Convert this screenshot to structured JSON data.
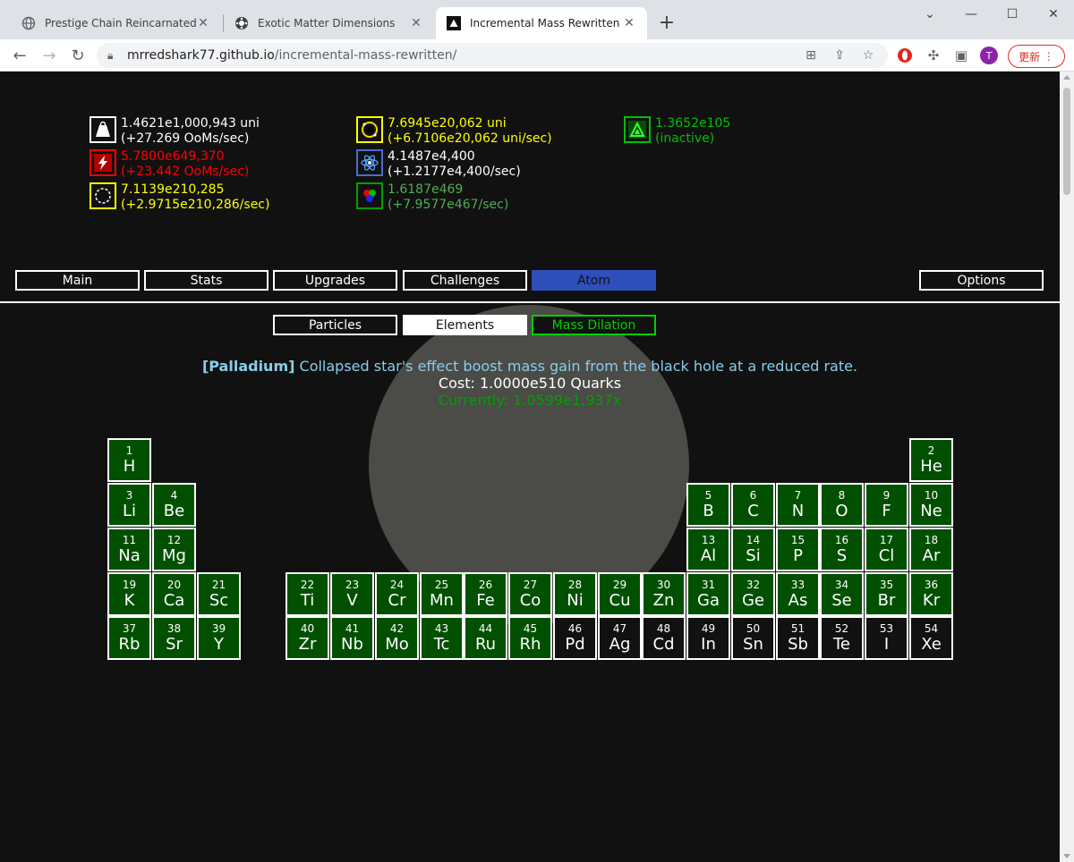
{
  "browser": {
    "tabs": [
      {
        "title": "Prestige Chain Reincarnated",
        "active": false
      },
      {
        "title": "Exotic Matter Dimensions",
        "active": false
      },
      {
        "title": "Incremental Mass Rewritten",
        "active": true
      }
    ],
    "url_host": "mrredshark77.github.io",
    "url_path": "/incremental-mass-rewritten/",
    "update_label": "更新",
    "avatar_letter": "T"
  },
  "resources": {
    "mass": {
      "value": "1.4621e1,000,943 uni",
      "rate": "(+27.269 OoMs/sec)",
      "color": "#ffffff"
    },
    "rage": {
      "value": "5.7800e649,370",
      "rate": "(+23.442 OoMs/sec)",
      "color": "#ff0000"
    },
    "dark": {
      "value": "7.1139e210,285",
      "rate": "(+2.9715e210,286/sec)",
      "color": "#ffff00"
    },
    "blackhole": {
      "value": "7.6945e20,062 uni",
      "rate": "(+6.7106e20,062 uni/sec)",
      "color": "#ffff00"
    },
    "atom": {
      "value": "4.1487e4,400",
      "rate": "(+1.2177e4,400/sec)",
      "color": "#ffffff"
    },
    "quark": {
      "value": "1.6187e469",
      "rate": "(+7.9577e467/sec)",
      "color": "#4caf50"
    },
    "dilation": {
      "value": "1.3652e105",
      "rate": "(inactive)",
      "color": "#00c000"
    }
  },
  "tabs": {
    "main": "Main",
    "stats": "Stats",
    "upgrades": "Upgrades",
    "challenges": "Challenges",
    "atom": "Atom",
    "options": "Options"
  },
  "subtabs": {
    "particles": "Particles",
    "elements": "Elements",
    "mass_dilation": "Mass Dilation"
  },
  "element_info": {
    "name": "[Palladium]",
    "desc": "Collapsed star's effect boost mass gain from the black hole at a reduced rate.",
    "cost": "Cost: 1.0000e510 Quarks",
    "current": "Currently: 1.0599e1,937x"
  },
  "colors": {
    "bought": "#005000",
    "unbought": "#111111",
    "active_tab": "#2f4fba",
    "info_blue": "#87ceeb",
    "info_green": "#00a000"
  },
  "elements": [
    {
      "n": "1",
      "s": "H",
      "bought": true
    },
    {
      "n": "2",
      "s": "He",
      "bought": true
    },
    {
      "n": "3",
      "s": "Li",
      "bought": true
    },
    {
      "n": "4",
      "s": "Be",
      "bought": true
    },
    {
      "n": "5",
      "s": "B",
      "bought": true
    },
    {
      "n": "6",
      "s": "C",
      "bought": true
    },
    {
      "n": "7",
      "s": "N",
      "bought": true
    },
    {
      "n": "8",
      "s": "O",
      "bought": true
    },
    {
      "n": "9",
      "s": "F",
      "bought": true
    },
    {
      "n": "10",
      "s": "Ne",
      "bought": true
    },
    {
      "n": "11",
      "s": "Na",
      "bought": true
    },
    {
      "n": "12",
      "s": "Mg",
      "bought": true
    },
    {
      "n": "13",
      "s": "Al",
      "bought": true
    },
    {
      "n": "14",
      "s": "Si",
      "bought": true
    },
    {
      "n": "15",
      "s": "P",
      "bought": true
    },
    {
      "n": "16",
      "s": "S",
      "bought": true
    },
    {
      "n": "17",
      "s": "Cl",
      "bought": true
    },
    {
      "n": "18",
      "s": "Ar",
      "bought": true
    },
    {
      "n": "19",
      "s": "K",
      "bought": true
    },
    {
      "n": "20",
      "s": "Ca",
      "bought": true
    },
    {
      "n": "21",
      "s": "Sc",
      "bought": true
    },
    {
      "n": "22",
      "s": "Ti",
      "bought": true
    },
    {
      "n": "23",
      "s": "V",
      "bought": true
    },
    {
      "n": "24",
      "s": "Cr",
      "bought": true
    },
    {
      "n": "25",
      "s": "Mn",
      "bought": true
    },
    {
      "n": "26",
      "s": "Fe",
      "bought": true
    },
    {
      "n": "27",
      "s": "Co",
      "bought": true
    },
    {
      "n": "28",
      "s": "Ni",
      "bought": true
    },
    {
      "n": "29",
      "s": "Cu",
      "bought": true
    },
    {
      "n": "30",
      "s": "Zn",
      "bought": true
    },
    {
      "n": "31",
      "s": "Ga",
      "bought": true
    },
    {
      "n": "32",
      "s": "Ge",
      "bought": true
    },
    {
      "n": "33",
      "s": "As",
      "bought": true
    },
    {
      "n": "34",
      "s": "Se",
      "bought": true
    },
    {
      "n": "35",
      "s": "Br",
      "bought": true
    },
    {
      "n": "36",
      "s": "Kr",
      "bought": true
    },
    {
      "n": "37",
      "s": "Rb",
      "bought": true
    },
    {
      "n": "38",
      "s": "Sr",
      "bought": true
    },
    {
      "n": "39",
      "s": "Y",
      "bought": true
    },
    {
      "n": "40",
      "s": "Zr",
      "bought": true
    },
    {
      "n": "41",
      "s": "Nb",
      "bought": true
    },
    {
      "n": "42",
      "s": "Mo",
      "bought": true
    },
    {
      "n": "43",
      "s": "Tc",
      "bought": true
    },
    {
      "n": "44",
      "s": "Ru",
      "bought": true
    },
    {
      "n": "45",
      "s": "Rh",
      "bought": true
    },
    {
      "n": "46",
      "s": "Pd",
      "bought": false
    },
    {
      "n": "47",
      "s": "Ag",
      "bought": false
    },
    {
      "n": "48",
      "s": "Cd",
      "bought": false
    },
    {
      "n": "49",
      "s": "In",
      "bought": false
    },
    {
      "n": "50",
      "s": "Sn",
      "bought": false
    },
    {
      "n": "51",
      "s": "Sb",
      "bought": false
    },
    {
      "n": "52",
      "s": "Te",
      "bought": false
    },
    {
      "n": "53",
      "s": "I",
      "bought": false
    },
    {
      "n": "54",
      "s": "Xe",
      "bought": false
    }
  ]
}
